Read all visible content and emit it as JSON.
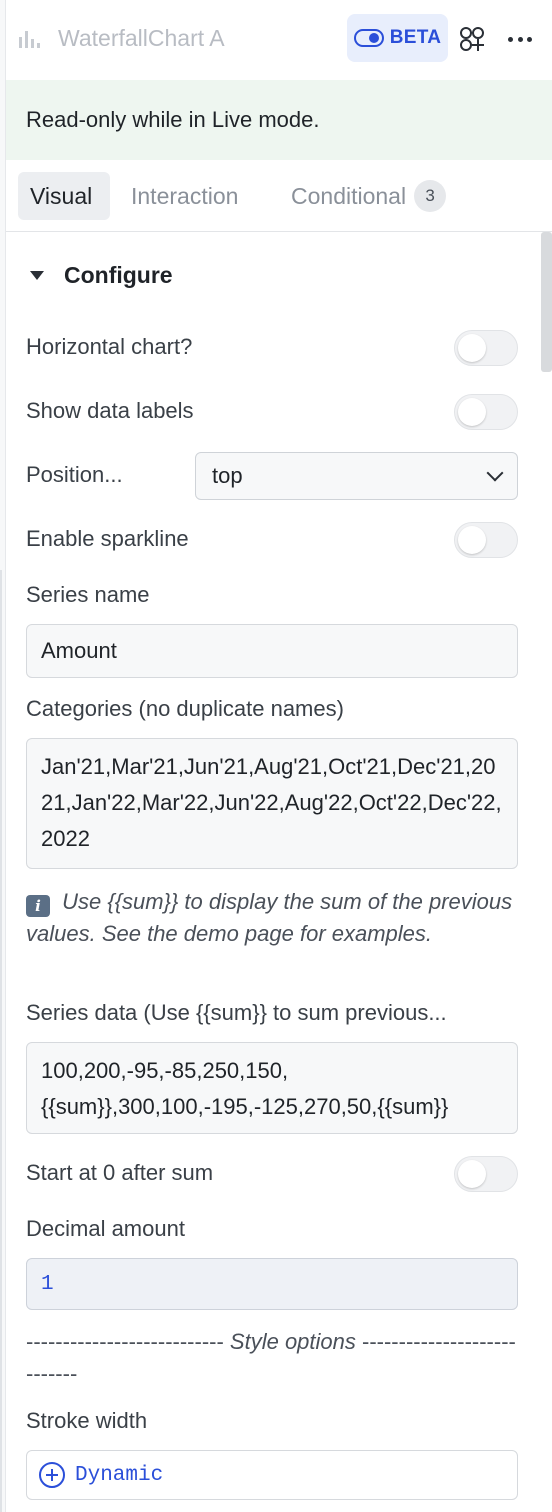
{
  "header": {
    "title": "WaterfallChart A",
    "title_icon": "bar-chart-icon",
    "beta_label": "BETA",
    "beta_icon": "toggle-icon",
    "apps_icon": "apps-add-icon",
    "more_icon": "more-horizontal-icon"
  },
  "banner": {
    "text": "Read-only while in Live mode."
  },
  "tabs": [
    {
      "label": "Visual",
      "active": true
    },
    {
      "label": "Interaction"
    },
    {
      "label": "Conditional",
      "count": "3"
    }
  ],
  "section": {
    "title": "Configure"
  },
  "fields": {
    "horizontal_chart": {
      "label": "Horizontal chart?",
      "on": false
    },
    "show_data_labels": {
      "label": "Show data labels",
      "on": false
    },
    "position": {
      "label": "Position...",
      "value": "top"
    },
    "enable_sparkline": {
      "label": "Enable sparkline",
      "on": false
    },
    "series_name": {
      "label": "Series name",
      "value": "Amount"
    },
    "categories": {
      "label": "Categories (no duplicate names)",
      "value": "Jan'21,Mar'21,Jun'21,Aug'21,Oct'21,Dec'21,2021,Jan'22,Mar'22,Jun'22,Aug'22,Oct'22,Dec'22,2022"
    },
    "hint": " Use {{sum}} to display the sum of the previous values. See the demo page for examples.",
    "series_data": {
      "label": "Series data (Use {{sum}} to sum previous...",
      "value_line1": "100,200,-95,-85,250,150,",
      "value_line2": "{{sum}},300,100,-195,-125,270,50,{{sum}}"
    },
    "start_at_zero": {
      "label": "Start at 0 after sum",
      "on": false
    },
    "decimal_amount": {
      "label": "Decimal amount",
      "value": "1"
    },
    "style_divider": {
      "dashes_left": "---------------------------",
      "text": " Style options ",
      "dashes_right": "----------------------------"
    },
    "stroke_width": {
      "label": "Stroke width",
      "button": "Dynamic"
    }
  },
  "colors": {
    "accent": "#2b4fd9",
    "banner_bg": "#eef6f0",
    "beta_bg": "#e8eefc"
  }
}
